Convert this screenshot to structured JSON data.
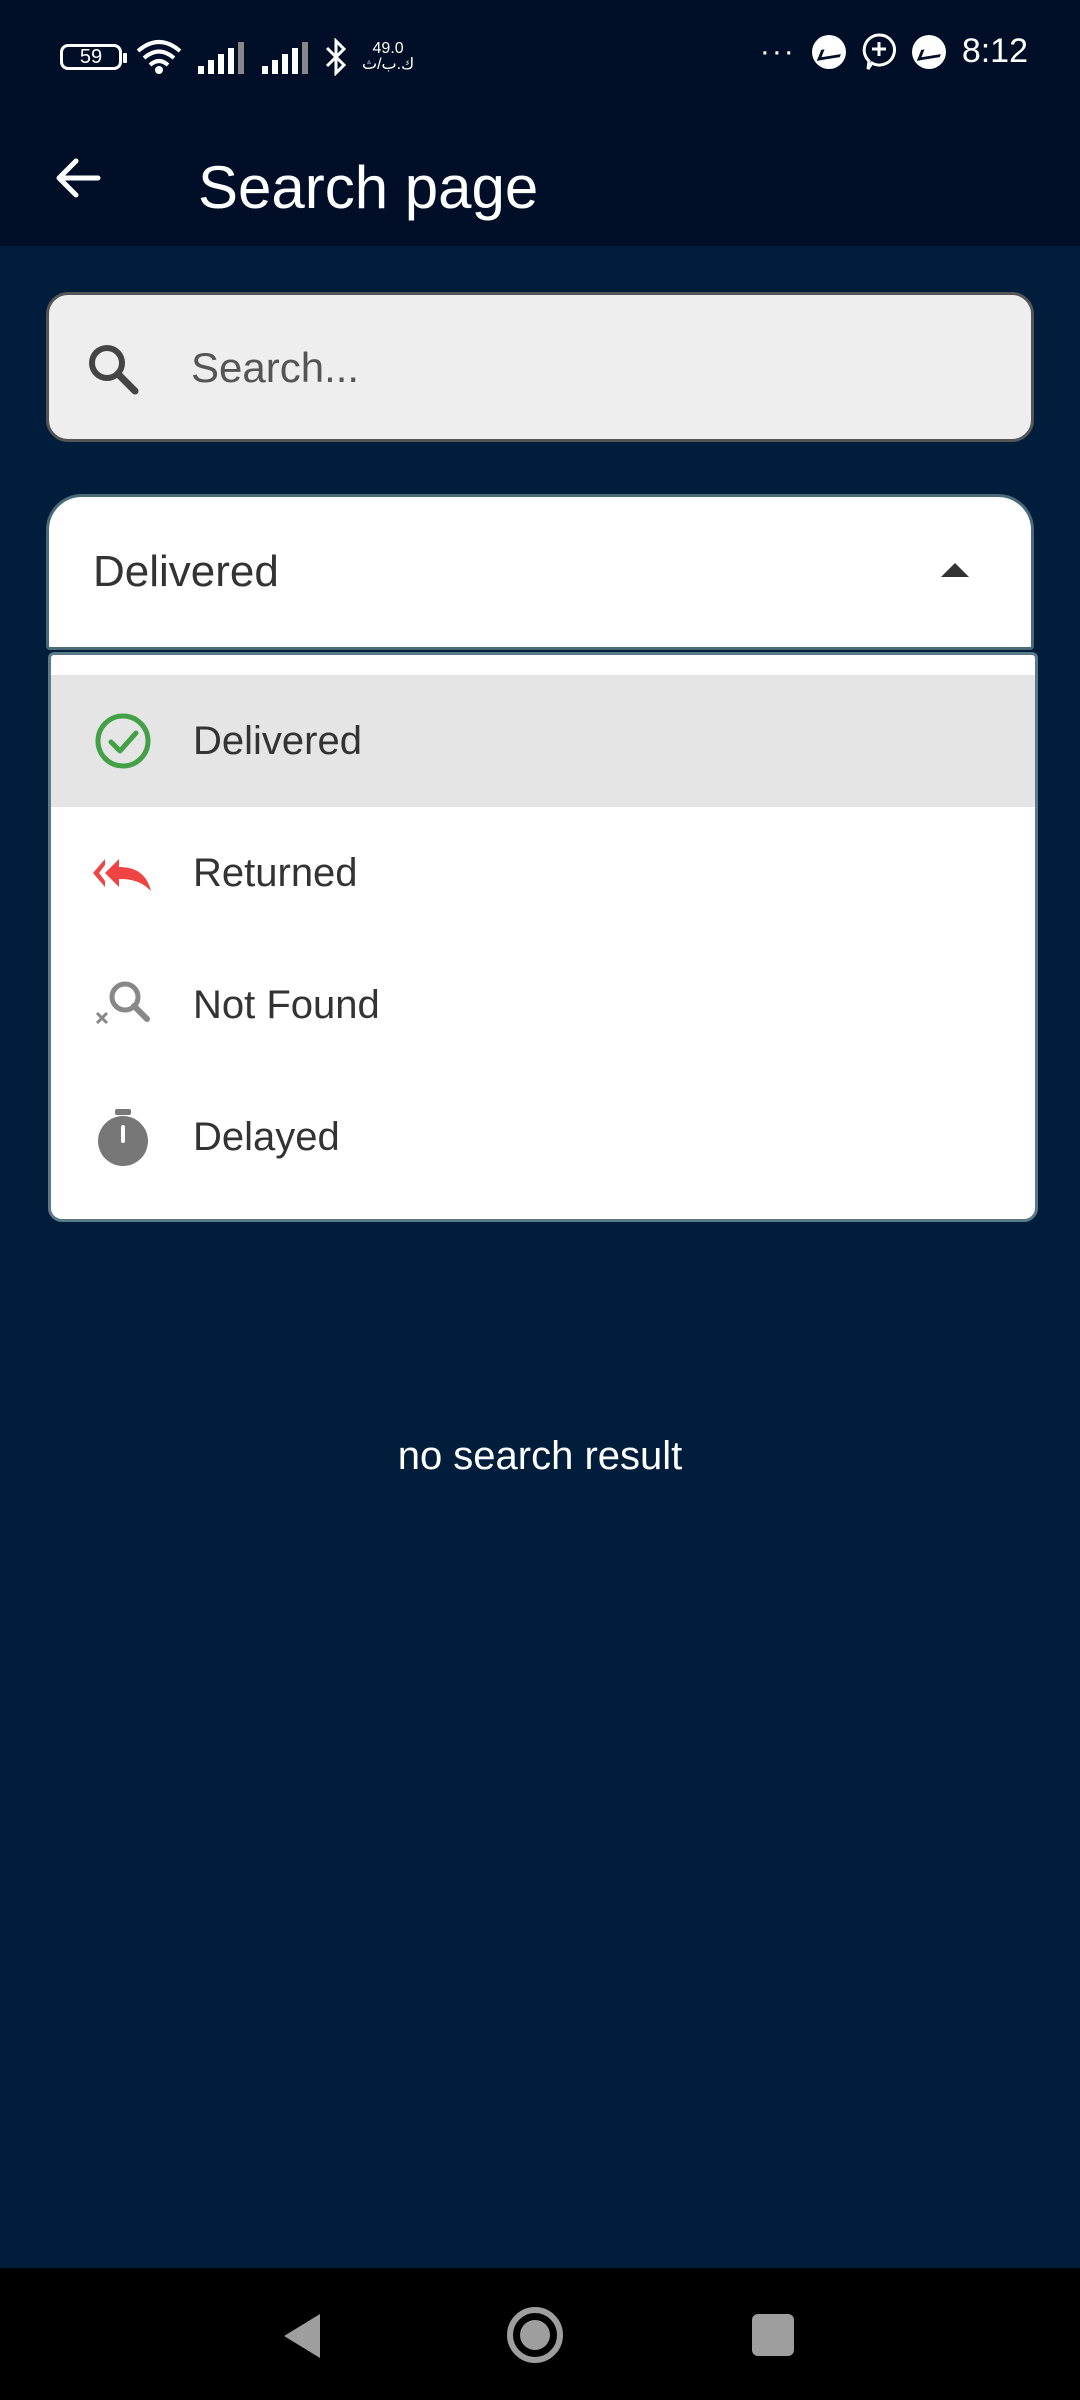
{
  "status_bar": {
    "battery": "59",
    "net_speed_value": "49.0",
    "net_speed_unit": "ك.ب/ث",
    "more": "···",
    "time": "8:12"
  },
  "app_bar": {
    "title": "Search page"
  },
  "search": {
    "placeholder": "Search..."
  },
  "status_filter": {
    "selected": "Delivered",
    "options": [
      {
        "label": "Delivered",
        "icon": "check-circle-icon",
        "color": "#43a047"
      },
      {
        "label": "Returned",
        "icon": "reply-all-icon",
        "color": "#ef4444"
      },
      {
        "label": "Not Found",
        "icon": "search-off-icon",
        "color": "#888888"
      },
      {
        "label": "Delayed",
        "icon": "timer-icon",
        "color": "#777777"
      }
    ]
  },
  "results": {
    "empty_message": "no search result"
  },
  "colors": {
    "background": "#001e3c",
    "app_bar": "#000f27",
    "selected_row": "#e5e5e5"
  }
}
